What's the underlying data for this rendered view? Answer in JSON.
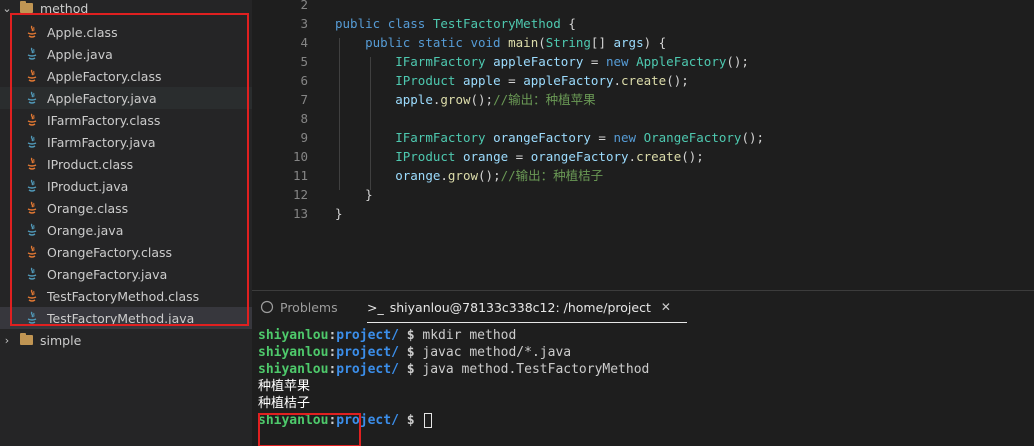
{
  "explorer": {
    "top_folder": "method",
    "files": [
      {
        "name": "Apple.class",
        "type": "class"
      },
      {
        "name": "Apple.java",
        "type": "java"
      },
      {
        "name": "AppleFactory.class",
        "type": "class"
      },
      {
        "name": "AppleFactory.java",
        "type": "java"
      },
      {
        "name": "IFarmFactory.class",
        "type": "class"
      },
      {
        "name": "IFarmFactory.java",
        "type": "java"
      },
      {
        "name": "IProduct.class",
        "type": "class"
      },
      {
        "name": "IProduct.java",
        "type": "java"
      },
      {
        "name": "Orange.class",
        "type": "class"
      },
      {
        "name": "Orange.java",
        "type": "java"
      },
      {
        "name": "OrangeFactory.class",
        "type": "class"
      },
      {
        "name": "OrangeFactory.java",
        "type": "java"
      },
      {
        "name": "TestFactoryMethod.class",
        "type": "class"
      },
      {
        "name": "TestFactoryMethod.java",
        "type": "java"
      }
    ],
    "bottom_folder": "simple",
    "colors": {
      "class_icon": "#e37933",
      "java_icon": "#519aba",
      "highlight_box": "#e02020"
    }
  },
  "editor": {
    "lines": [
      {
        "num": "2",
        "text": ""
      },
      {
        "num": "3",
        "text": "public class TestFactoryMethod {"
      },
      {
        "num": "4",
        "text": "    public static void main(String[] args) {"
      },
      {
        "num": "5",
        "text": "        IFarmFactory appleFactory = new AppleFactory();"
      },
      {
        "num": "6",
        "text": "        IProduct apple = appleFactory.create();"
      },
      {
        "num": "7",
        "text": "        apple.grow();//输出：种植苹果"
      },
      {
        "num": "8",
        "text": ""
      },
      {
        "num": "9",
        "text": "        IFarmFactory orangeFactory = new OrangeFactory();"
      },
      {
        "num": "10",
        "text": "        IProduct orange = orangeFactory.create();"
      },
      {
        "num": "11",
        "text": "        orange.grow();//输出：种植桔子"
      },
      {
        "num": "12",
        "text": "    }"
      },
      {
        "num": "13",
        "text": "}"
      }
    ]
  },
  "panel": {
    "tabs": {
      "problems": "Problems",
      "terminal": "shiyanlou@78133c338c12: /home/project"
    },
    "prompt": {
      "user": "shiyanlou",
      "dir": "project/",
      "symbol": "$"
    },
    "commands": [
      "mkdir method",
      "javac method/*.java",
      "java method.TestFactoryMethod"
    ],
    "output": [
      "种植苹果",
      "种植桔子"
    ]
  }
}
